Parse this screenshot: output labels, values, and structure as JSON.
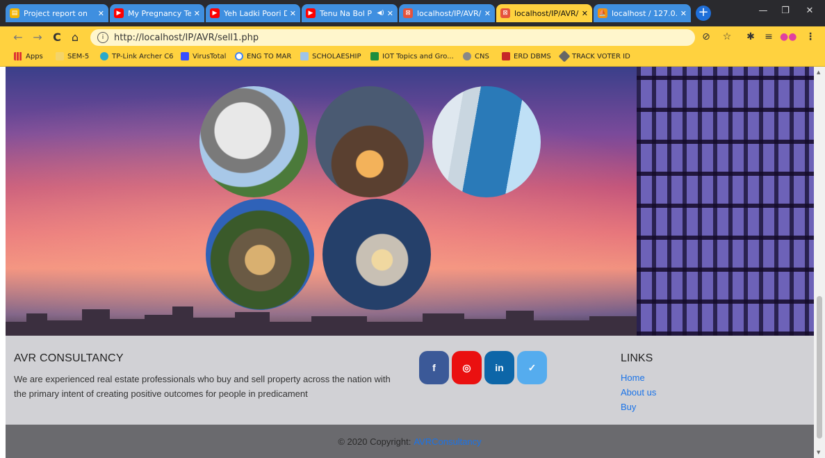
{
  "browser": {
    "tabs": [
      {
        "title": "Project report on",
        "color": "#f4b400"
      },
      {
        "title": "My Pregnancy Tes",
        "color": "#ff0000"
      },
      {
        "title": "Yeh Ladki Poori Di",
        "color": "#ff0000"
      },
      {
        "title": "Tenu Na Bol P",
        "color": "#ff0000"
      },
      {
        "title": "localhost/IP/AVR/",
        "color": "#e5533c"
      },
      {
        "title": "localhost/IP/AVR/",
        "color": "#e5533c"
      },
      {
        "title": "localhost / 127.0.0",
        "color": "#f29111"
      }
    ],
    "address": "http://localhost/IP/AVR/sell1.php",
    "bookmarks": [
      "Apps",
      "SEM-5",
      "TP-Link Archer C6",
      "VirusTotal",
      "ENG TO MAR",
      "SCHOLAESHIP",
      "IOT Topics and Gro...",
      "CNS",
      "ERD DBMS",
      "TRACK VOTER ID"
    ]
  },
  "footer": {
    "brand": "AVR CONSULTANCY",
    "description": "We are experienced real estate professionals who buy and sell property across the nation with the primary intent of creating positive outcomes for people in predicament",
    "social": [
      {
        "label": "f",
        "icon": "facebook-icon",
        "color": "#3b5998"
      },
      {
        "label": "◎",
        "icon": "instagram-icon",
        "color": "#ea1010"
      },
      {
        "label": "in",
        "icon": "linkedin-icon",
        "color": "#0d66a8"
      },
      {
        "label": "✓",
        "icon": "twitter-icon",
        "color": "#55acee"
      }
    ],
    "links_title": "LINKS",
    "links": [
      "Home",
      "About us",
      "Buy"
    ],
    "copyright_prefix": "© 2020 Copyright:",
    "copyright_link": "AVRConsultancy"
  }
}
